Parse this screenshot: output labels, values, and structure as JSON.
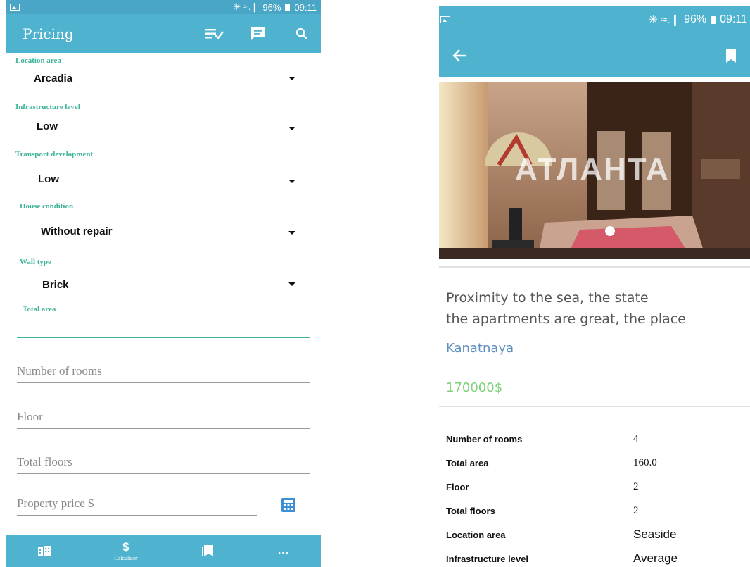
{
  "left": {
    "status": {
      "signal": "✳ ≈.❙",
      "battery": "96%",
      "time": "09:11"
    },
    "appbar": {
      "title": "Pricing"
    },
    "fields": [
      {
        "label": "Location area",
        "value": "Arcadia"
      },
      {
        "label": "Infrastructure level",
        "value": "Low"
      },
      {
        "label": "Transport development",
        "value": "Low"
      },
      {
        "label": "House condition",
        "value": "Without repair"
      },
      {
        "label": "Wall type",
        "value": "Brick"
      }
    ],
    "total_area_label": "Total area",
    "inputs": [
      {
        "placeholder": "Number of rooms"
      },
      {
        "placeholder": "Floor"
      },
      {
        "placeholder": "Total floors"
      },
      {
        "placeholder": "Property price $"
      }
    ],
    "bottom_nav": {
      "calculator_symbol": "$",
      "calculator_label": "Calculator",
      "more": "..."
    }
  },
  "right": {
    "status": {
      "signal": "✳ ≈.❙",
      "battery": "96%",
      "time": "09:11"
    },
    "watermark": "АТЛАНТА",
    "description": "Proximity to the sea, the state\nthe apartments are great, the place",
    "street": "Kanatnaya",
    "price": "170000$",
    "specs": [
      {
        "key": "Number of rooms",
        "value": "4"
      },
      {
        "key": "Total area",
        "value": "160.0"
      },
      {
        "key": "Floor",
        "value": "2"
      },
      {
        "key": "Total floors",
        "value": "2"
      },
      {
        "key": "Location area",
        "value": "Seaside"
      },
      {
        "key": "Infrastructure level",
        "value": "Average"
      }
    ]
  },
  "colors": {
    "appbar": "#4fb3cf",
    "label_green": "#3fb39a",
    "street_blue": "#5f8fc2",
    "price_green": "#7fd07a"
  }
}
